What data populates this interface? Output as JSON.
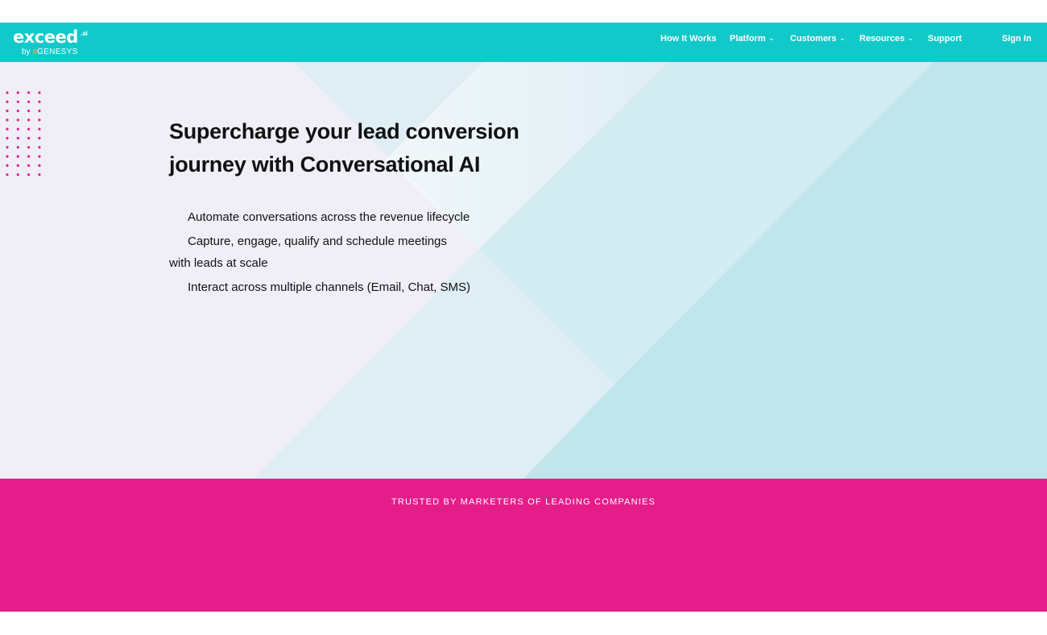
{
  "brand": {
    "logo_word": "exceed",
    "logo_suffix": ".ai",
    "logo_by": "by",
    "logo_genesys": "GENESYS"
  },
  "nav": {
    "how_it_works": "How It Works",
    "platform": "Platform",
    "customers": "Customers",
    "resources": "Resources",
    "support": "Support",
    "sign_in": "Sign In"
  },
  "hero": {
    "headline": "Supercharge your lead conversion journey with Conversational AI",
    "bullet_1": "Automate conversations across the revenue lifecycle",
    "bullet_2_line_1": "Capture, engage, qualify and schedule meetings",
    "bullet_2_line_2": "with leads at scale",
    "bullet_3": "Interact across multiple channels (Email, Chat, SMS)"
  },
  "trusted": {
    "title": "TRUSTED BY MARKETERS OF LEADING COMPANIES"
  },
  "colors": {
    "nav_bg": "#12c9c9",
    "hero_bg": "#f0eff8",
    "hero_teal": "#c0e6eb",
    "accent_pink": "#e41d8a"
  },
  "icons": {
    "dropdown": "chevron-down-icon"
  }
}
